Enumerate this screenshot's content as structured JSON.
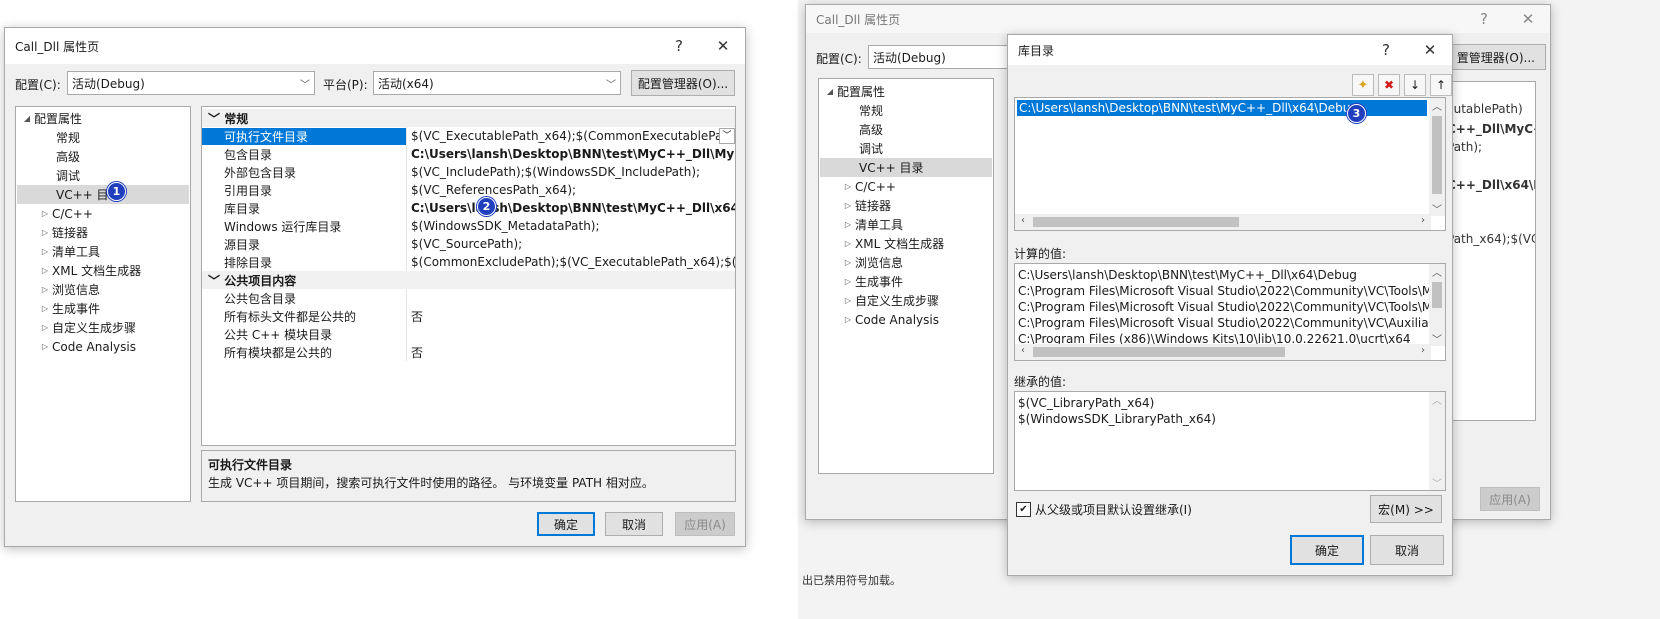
{
  "left": {
    "title": "Call_Dll 属性页",
    "help": "?",
    "close": "✕",
    "config_label": "配置(C):",
    "config_value": "活动(Debug)",
    "platform_label": "平台(P):",
    "platform_value": "活动(x64)",
    "config_manager": "配置管理器(O)...",
    "tree": [
      {
        "label": "配置属性",
        "exp": "◢"
      },
      {
        "label": "常规",
        "exp": ""
      },
      {
        "label": "高级",
        "exp": ""
      },
      {
        "label": "调试",
        "exp": ""
      },
      {
        "label": "VC++ 目",
        "exp": ""
      },
      {
        "label": "C/C++",
        "exp": "▷"
      },
      {
        "label": "链接器",
        "exp": "▷"
      },
      {
        "label": "清单工具",
        "exp": "▷"
      },
      {
        "label": "XML 文档生成器",
        "exp": "▷"
      },
      {
        "label": "浏览信息",
        "exp": "▷"
      },
      {
        "label": "生成事件",
        "exp": "▷"
      },
      {
        "label": "自定义生成步骤",
        "exp": "▷"
      },
      {
        "label": "Code Analysis",
        "exp": "▷"
      }
    ],
    "cat_general": "常规",
    "rows_general": [
      {
        "name": "可执行文件目录",
        "value": "$(VC_ExecutablePath_x64);$(CommonExecutablePath)"
      },
      {
        "name": "包含目录",
        "value": "C:\\Users\\lansh\\Desktop\\BNN\\test\\MyC++_Dll\\MyC++"
      },
      {
        "name": "外部包含目录",
        "value": "$(VC_IncludePath);$(WindowsSDK_IncludePath);"
      },
      {
        "name": "引用目录",
        "value": "$(VC_ReferencesPath_x64);"
      },
      {
        "name": "库目录",
        "value": "C:\\Users\\lansh\\Desktop\\BNN\\test\\MyC++_Dll\\x64\\D"
      },
      {
        "name": "Windows 运行库目录",
        "value": "$(WindowsSDK_MetadataPath);"
      },
      {
        "name": "源目录",
        "value": "$(VC_SourcePath);"
      },
      {
        "name": "排除目录",
        "value": "$(CommonExcludePath);$(VC_ExecutablePath_x64);$(VC_L"
      }
    ],
    "cat_public": "公共项目内容",
    "rows_public": [
      {
        "name": "公共包含目录",
        "value": ""
      },
      {
        "name": "所有标头文件都是公共的",
        "value": "否"
      },
      {
        "name": "公共 C++ 模块目录",
        "value": ""
      },
      {
        "name": "所有模块都是公共的",
        "value": "否"
      }
    ],
    "desc_title": "可执行文件目录",
    "desc_text": "生成 VC++ 项目期间，搜索可执行文件时使用的路径。 与环境变量 PATH 相对应。",
    "ok": "确定",
    "cancel": "取消",
    "apply": "应用(A)",
    "badge1": "1",
    "badge2": "2"
  },
  "right": {
    "title": "Call_Dll 属性页",
    "help": "?",
    "close": "✕",
    "config_label": "配置(C):",
    "config_value": "活动(Debug)",
    "config_manager": "置管理器(O)...",
    "tree": [
      {
        "label": "配置属性",
        "exp": "◢"
      },
      {
        "label": "常规",
        "exp": ""
      },
      {
        "label": "高级",
        "exp": ""
      },
      {
        "label": "调试",
        "exp": ""
      },
      {
        "label": "VC++ 目录",
        "exp": ""
      },
      {
        "label": "C/C++",
        "exp": "▷"
      },
      {
        "label": "链接器",
        "exp": "▷"
      },
      {
        "label": "清单工具",
        "exp": "▷"
      },
      {
        "label": "XML 文档生成器",
        "exp": "▷"
      },
      {
        "label": "浏览信息",
        "exp": "▷"
      },
      {
        "label": "生成事件",
        "exp": "▷"
      },
      {
        "label": "自定义生成步骤",
        "exp": "▷"
      },
      {
        "label": "Code Analysis",
        "exp": "▷"
      }
    ],
    "peek": [
      "cutablePath)",
      "C++_Dll\\MyC+",
      "Path);",
      "C++_Dll\\x64\\D",
      "Path_x64);$(VC_"
    ],
    "apply": "应用(A)"
  },
  "lib": {
    "title": "库目录",
    "help": "?",
    "close": "✕",
    "entry": "C:\\Users\\lansh\\Desktop\\BNN\\test\\MyC++_Dll\\x64\\Debug",
    "badge3": "3",
    "computed_label": "计算的值:",
    "computed": [
      "C:\\Users\\lansh\\Desktop\\BNN\\test\\MyC++_Dll\\x64\\Debug",
      "C:\\Program Files\\Microsoft Visual Studio\\2022\\Community\\VC\\Tools\\MSVC",
      "C:\\Program Files\\Microsoft Visual Studio\\2022\\Community\\VC\\Tools\\MSVC",
      "C:\\Program Files\\Microsoft Visual Studio\\2022\\Community\\VC\\Auxiliary\\VS",
      "C:\\Program Files (x86)\\Windows Kits\\10\\lib\\10.0.22621.0\\ucrt\\x64"
    ],
    "inherited_label": "继承的值:",
    "inherited": [
      "$(VC_LibraryPath_x64)",
      "$(WindowsSDK_LibraryPath_x64)"
    ],
    "inherit_checkbox": "从父级或项目默认设置继承(I)",
    "macro": "宏(M) >>",
    "ok": "确定",
    "cancel": "取消"
  },
  "bg_text": "出已禁用符号加载。"
}
